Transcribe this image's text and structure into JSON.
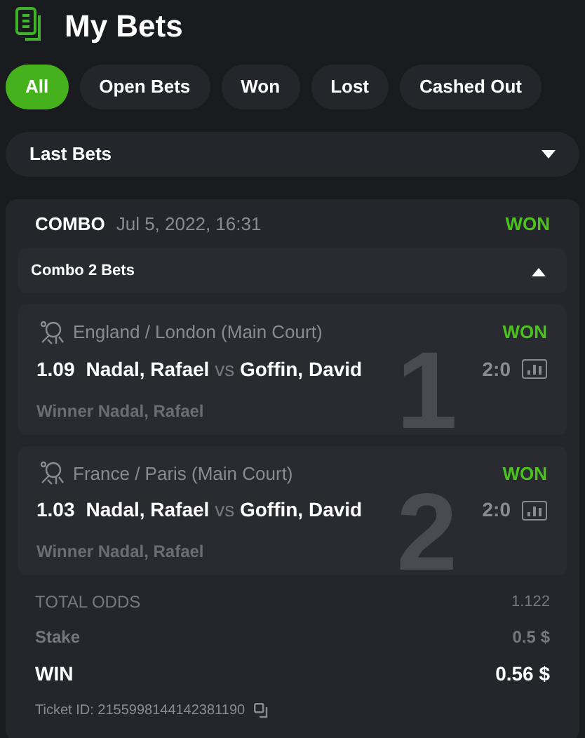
{
  "header": {
    "title": "My Bets"
  },
  "tabs": [
    {
      "label": "All",
      "selected": true
    },
    {
      "label": "Open Bets",
      "selected": false
    },
    {
      "label": "Won",
      "selected": false
    },
    {
      "label": "Lost",
      "selected": false
    },
    {
      "label": "Cashed Out",
      "selected": false
    }
  ],
  "filter": {
    "value": "Last Bets",
    "expanded": false
  },
  "bet": {
    "type": "COMBO",
    "date": "Jul 5, 2022, 16:31",
    "status": "WON",
    "group": {
      "label": "Combo 2 Bets",
      "expanded": true
    },
    "legs": [
      {
        "index": "1",
        "venue": "England / London (Main Court)",
        "status": "WON",
        "odds": "1.09",
        "home": "Nadal, Rafael",
        "vs": "vs",
        "away": "Goffin, David",
        "score": "2:0",
        "pick": "Winner Nadal, Rafael"
      },
      {
        "index": "2",
        "venue": "France / Paris (Main Court)",
        "status": "WON",
        "odds": "1.03",
        "home": "Nadal, Rafael",
        "vs": "vs",
        "away": "Goffin, David",
        "score": "2:0",
        "pick": "Winner Nadal, Rafael"
      }
    ],
    "total_odds": {
      "label": "TOTAL ODDS",
      "value": "1.122"
    },
    "stake": {
      "label": "Stake",
      "value": "0.5 $"
    },
    "win": {
      "label": "WIN",
      "value": "0.56 $"
    },
    "ticket": "Ticket ID: 2155998144142381190"
  }
}
